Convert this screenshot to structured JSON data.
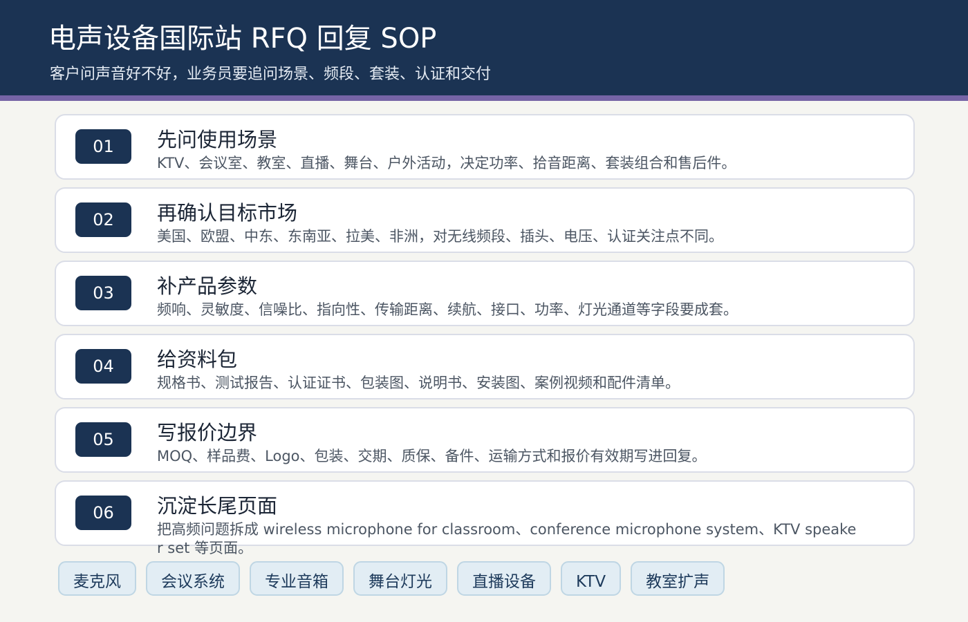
{
  "header": {
    "title": "电声设备国际站 RFQ 回复 SOP",
    "subtitle": "客户问声音好不好，业务员要追问场景、频段、套装、认证和交付",
    "colors": {
      "background": "#1b3353",
      "accent_bar": "#7664a6"
    }
  },
  "steps": [
    {
      "num": "01",
      "title": "先问使用场景",
      "desc": "KTV、会议室、教室、直播、舞台、户外活动，决定功率、拾音距离、套装组合和售后件。"
    },
    {
      "num": "02",
      "title": "再确认目标市场",
      "desc": "美国、欧盟、中东、东南亚、拉美、非洲，对无线频段、插头、电压、认证关注点不同。"
    },
    {
      "num": "03",
      "title": "补产品参数",
      "desc": "频响、灵敏度、信噪比、指向性、传输距离、续航、接口、功率、灯光通道等字段要成套。"
    },
    {
      "num": "04",
      "title": "给资料包",
      "desc": "规格书、测试报告、认证证书、包装图、说明书、安装图、案例视频和配件清单。"
    },
    {
      "num": "05",
      "title": "写报价边界",
      "desc": "MOQ、样品费、Logo、包装、交期、质保、备件、运输方式和报价有效期写进回复。"
    },
    {
      "num": "06",
      "title": "沉淀长尾页面",
      "desc": "把高频问题拆成 wireless microphone for classroom、conference microphone system、KTV speaker set 等页面。"
    }
  ],
  "tags": [
    "麦克风",
    "会议系统",
    "专业音箱",
    "舞台灯光",
    "直播设备",
    "KTV",
    "教室扩声"
  ]
}
